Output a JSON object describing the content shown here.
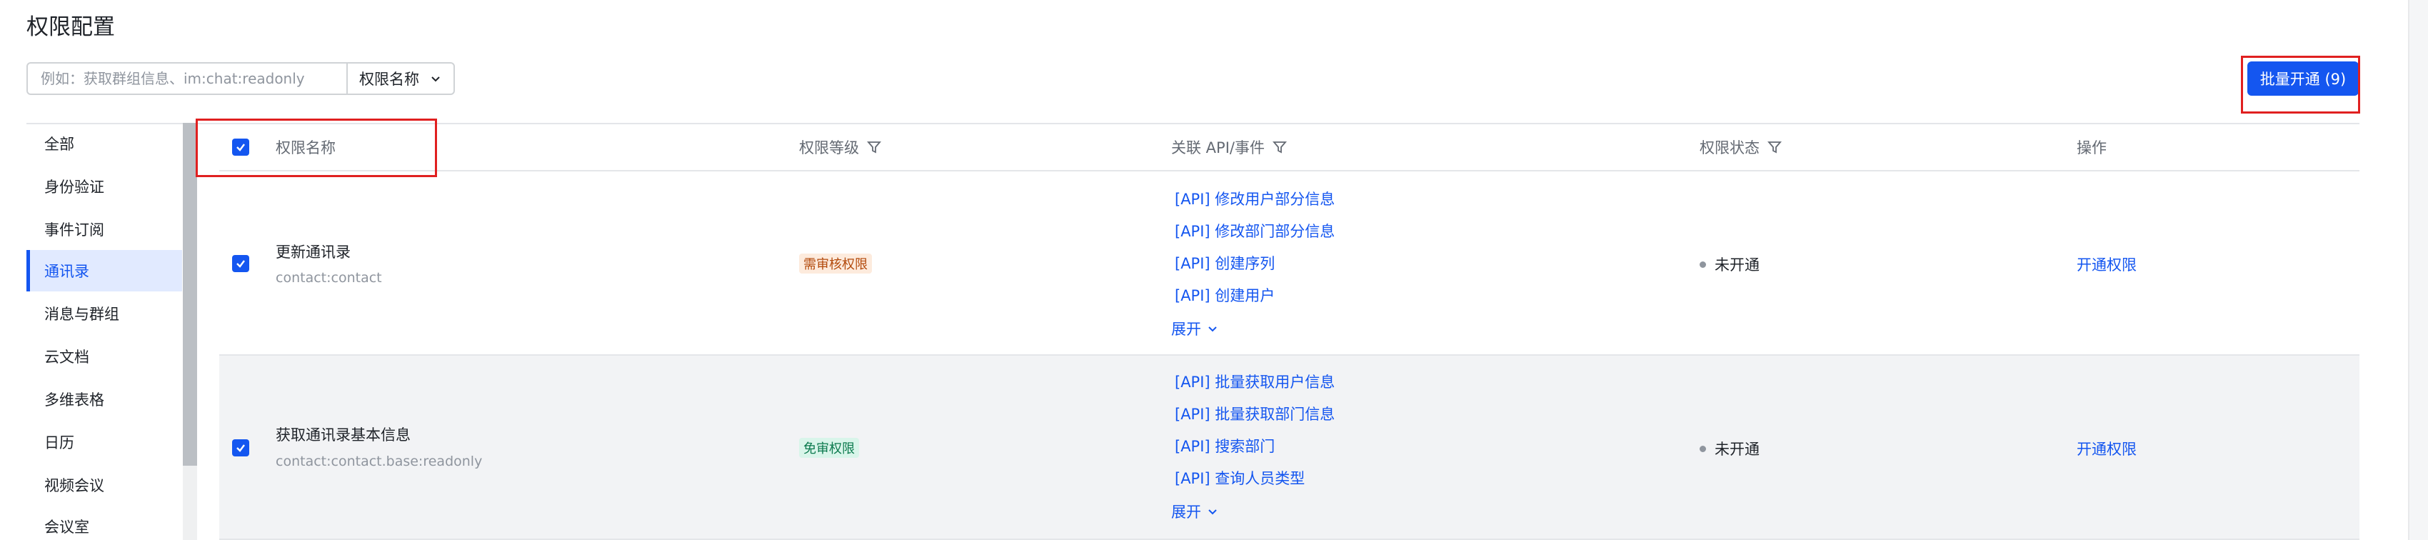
{
  "page": {
    "title": "权限配置"
  },
  "search": {
    "placeholder": "例如：获取群组信息、im:chat:readonly",
    "select_label": "权限名称"
  },
  "batch_button": {
    "label": "批量开通 (9)"
  },
  "sidebar": {
    "items": [
      {
        "label": "全部",
        "active": false
      },
      {
        "label": "身份验证",
        "active": false
      },
      {
        "label": "事件订阅",
        "active": false
      },
      {
        "label": "通讯录",
        "active": true
      },
      {
        "label": "消息与群组",
        "active": false
      },
      {
        "label": "云文档",
        "active": false
      },
      {
        "label": "多维表格",
        "active": false
      },
      {
        "label": "日历",
        "active": false
      },
      {
        "label": "视频会议",
        "active": false
      },
      {
        "label": "会议室",
        "active": false
      }
    ]
  },
  "table": {
    "headers": {
      "name": "权限名称",
      "level": "权限等级",
      "api": "关联 API/事件",
      "status": "权限状态",
      "action": "操作"
    },
    "rows": [
      {
        "name": "更新通讯录",
        "code": "contact:contact",
        "level": "需审核权限",
        "apis": [
          "[API] 修改用户部分信息",
          "[API] 修改部门部分信息",
          "[API] 创建序列",
          "[API] 创建用户"
        ],
        "expand": "展开",
        "status": "未开通",
        "action": "开通权限"
      },
      {
        "name": "获取通讯录基本信息",
        "code": "contact:contact.base:readonly",
        "level": "免审权限",
        "apis": [
          "[API] 批量获取用户信息",
          "[API] 批量获取部门信息",
          "[API] 搜索部门",
          "[API] 查询人员类型"
        ],
        "expand": "展开",
        "status": "未开通",
        "action": "开通权限"
      }
    ]
  },
  "colors": {
    "accent": "#1456f0",
    "highlight_box": "#e02020",
    "review_tag_bg": "#fdebdd",
    "free_tag_bg": "#d9f5ea"
  }
}
